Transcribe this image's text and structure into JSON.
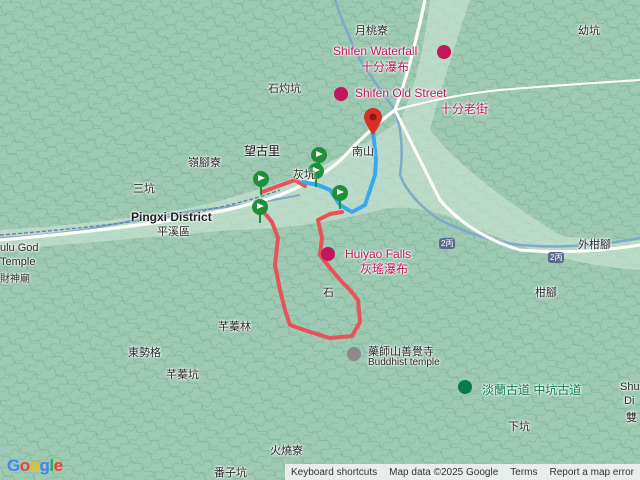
{
  "labels": {
    "yuetaoliao": "月桃寮",
    "shifen_waterfall_en": "Shifen Waterfall",
    "shifen_waterfall_zh": "十分瀑布",
    "shifen_old_street_en": "Shifen Old Street",
    "shifen_old_street_zh": "十分老街",
    "youkeng": "幼坑",
    "shizhuokeng": "石灼坑",
    "wangguli": "望古里",
    "lingjiaoliao": "嶺腳寮",
    "nanshan": "南山",
    "sankeng": "三坑",
    "pingxi_en": "Pingxi District",
    "pingxi_zh": "平溪區",
    "huiyao_en": "Huiyao Falls",
    "huiyao_zh": "灰瑤瀑布",
    "shi": "石",
    "huikeng": "灰坑",
    "wai_ganjiao": "外柑腳",
    "ganjiao": "柑腳",
    "zhuqinlin": "芊蓁林",
    "dongshige": "東勢格",
    "zhuqinkeng": "芊蓁坑",
    "yaoshishan_zh": "藥師山善覺寺",
    "yaoshishan_en": "Buddhist temple",
    "danlan_zh": "淡蘭古道 中坑古道",
    "huoshaoliao": "火燒寮",
    "xiakeng": "下坑",
    "zhuzikeng": "番子坑",
    "left_edge_1": "ulu God",
    "left_edge_2": "Temple",
    "left_edge_3": "財神廟",
    "right_edge_1": "Shu",
    "right_edge_2": "Di",
    "right_edge_3": "雙"
  },
  "road_badges": [
    "2丙",
    "2丙"
  ],
  "footer": {
    "shortcuts": "Keyboard shortcuts",
    "mapdata": "Map data ©2025 Google",
    "terms": "Terms",
    "report": "Report a map error"
  },
  "logo": "Google",
  "colors": {
    "track_red": "#e8535a",
    "track_blue": "#38a9ee",
    "pin_green": "#1f8f3a",
    "pin_red": "#d93025",
    "terrain": "#9cc9b3"
  }
}
